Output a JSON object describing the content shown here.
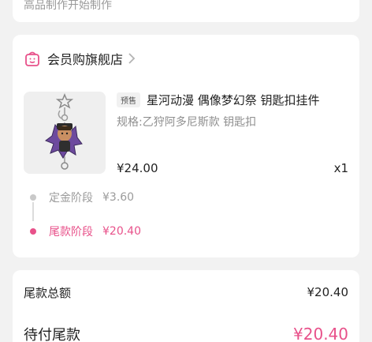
{
  "top_card": {
    "cut_text": "高品制作开始制作"
  },
  "store": {
    "name": "会员购旗舰店",
    "icon": "shopping-bag-icon",
    "accent": "#e8518a"
  },
  "product": {
    "tag": "预售",
    "title": "星河动漫 偶像梦幻祭 钥匙扣挂件",
    "spec": "规格:乙狩阿多尼斯款 钥匙扣",
    "price": "¥24.00",
    "quantity": "x1"
  },
  "stages": [
    {
      "label": "定金阶段",
      "amount": "¥3.60",
      "active": false
    },
    {
      "label": "尾款阶段",
      "amount": "¥20.40",
      "active": true
    }
  ],
  "summary": {
    "balance_total_label": "尾款总额",
    "balance_total_value": "¥20.40",
    "pending_label": "待付尾款",
    "pending_value": "¥20.40"
  }
}
